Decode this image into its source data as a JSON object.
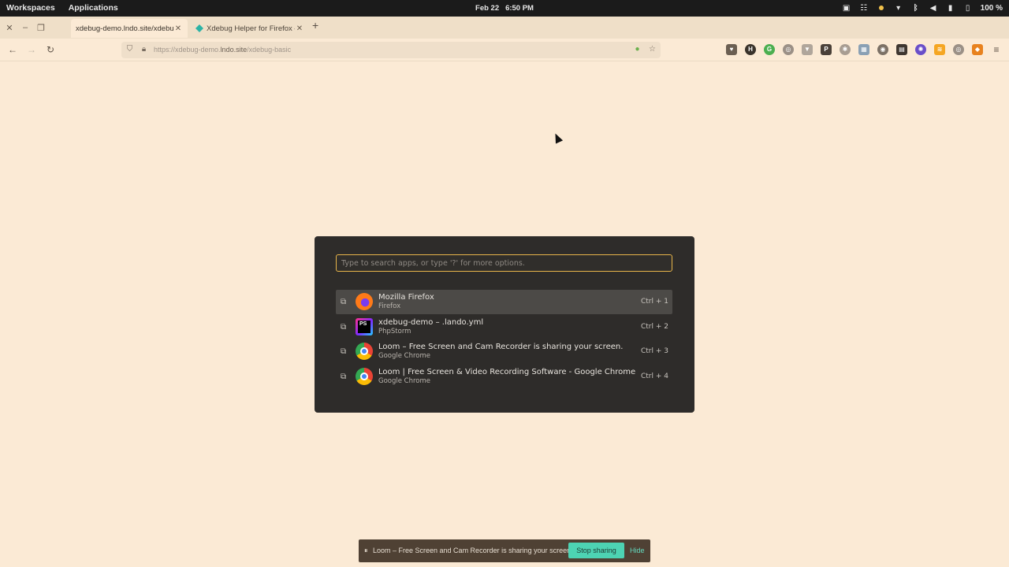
{
  "panel": {
    "workspaces": "Workspaces",
    "applications": "Applications",
    "date": "Feb 22",
    "time": "6:50 PM",
    "battery": "100 %"
  },
  "tabs": [
    {
      "title": "xdebug-demo.lndo.site/xdebug_basic",
      "active": true
    },
    {
      "title": "Xdebug Helper for Firefox – ",
      "active": false
    }
  ],
  "nav": {
    "url_prefix": "https://xdebug-demo.",
    "url_domain": "lndo.site",
    "url_path": "/xdebug-basic"
  },
  "launcher": {
    "placeholder": "Type to search apps, or type '?' for more options.",
    "results": [
      {
        "name": "Mozilla Firefox",
        "sub": "Firefox",
        "shortcut": "Ctrl + 1",
        "icon": "firefox-icon"
      },
      {
        "name": "xdebug-demo – .lando.yml",
        "sub": "PhpStorm",
        "shortcut": "Ctrl + 2",
        "icon": "phpstorm-icon"
      },
      {
        "name": "Loom – Free Screen and Cam Recorder is sharing your screen.",
        "sub": "Google Chrome",
        "shortcut": "Ctrl + 3",
        "icon": "chrome-icon"
      },
      {
        "name": "Loom | Free Screen & Video Recording Software - Google Chrome",
        "sub": "Google Chrome",
        "shortcut": "Ctrl + 4",
        "icon": "chrome-icon"
      }
    ]
  },
  "share": {
    "message": "Loom – Free Screen and Cam Recorder is sharing your screen.",
    "stop": "Stop sharing",
    "hide": "Hide"
  },
  "colors": {
    "page_bg": "#fbead5",
    "launcher_bg": "#2e2c2a",
    "accent": "#e8b54a",
    "stop_btn": "#4dd3b3"
  }
}
